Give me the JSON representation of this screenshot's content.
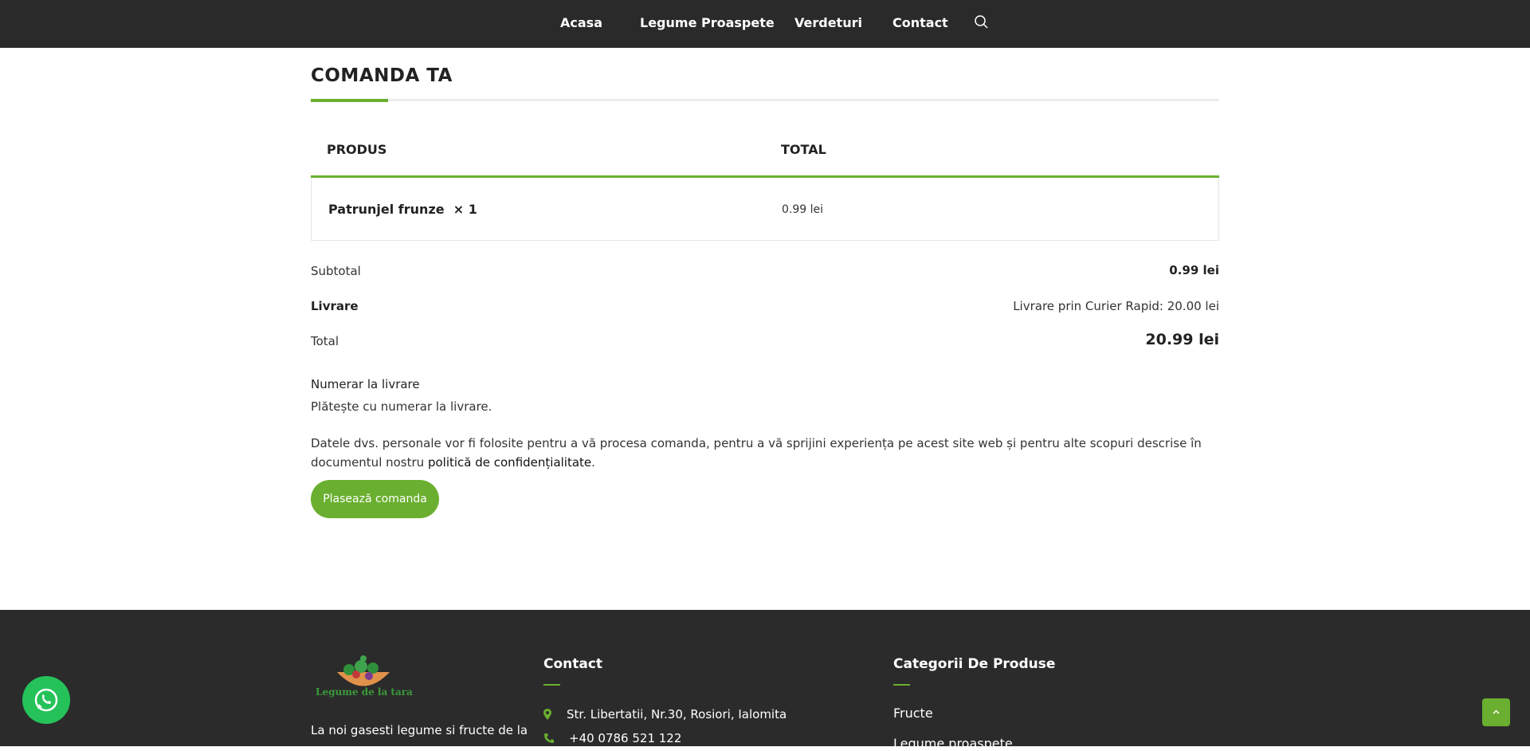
{
  "nav": {
    "items": [
      "Acasa",
      "Legume Proaspete",
      "Verdeturi",
      "Contact"
    ]
  },
  "order": {
    "title": "COMANDA TA",
    "table": {
      "headers": [
        "PRODUS",
        "TOTAL"
      ],
      "rows": [
        {
          "product": "Patrunjel frunze",
          "quantity": "× 1",
          "total": "0.99 lei"
        }
      ]
    },
    "summary": {
      "subtotal_label": "Subtotal",
      "subtotal_value": "0.99 lei",
      "shipping_label": "Livrare",
      "shipping_value": "Livrare prin Curier Rapid: 20.00 lei",
      "total_label": "Total",
      "total_value": "20.99 lei"
    },
    "payment": {
      "method": "Numerar la livrare",
      "description": "Plătește cu numerar la livrare."
    },
    "privacy": {
      "text_before": "Datele dvs. personale vor fi folosite pentru a vă procesa comanda, pentru a vă sprijini experiența pe acest site web și pentru alte scopuri descrise în documentul nostru ",
      "link": "politică de confidențialitate",
      "text_after": "."
    },
    "place_order_label": "Plasează comanda"
  },
  "footer": {
    "logo_text": "Legume de la tara",
    "about": "La noi gasesti legume si fructe de la",
    "contact_title": "Contact",
    "address": "Str. Libertatii, Nr.30, Rosiori, Ialomita",
    "phone": "+40 0786 521 122",
    "categories_title": "Categorii De Produse",
    "categories": [
      "Fructe",
      "Legume proaspete"
    ]
  },
  "colors": {
    "accent": "#6aaf2f",
    "nav_bg": "#2a2a2a",
    "footer_bg": "#2b2b2b",
    "whatsapp": "#25c25a"
  }
}
